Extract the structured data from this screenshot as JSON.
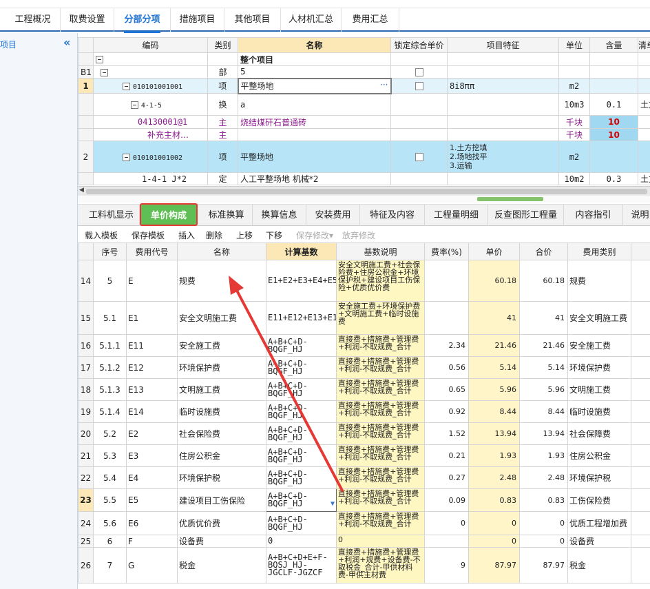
{
  "top_tabs": [
    "工程概况",
    "取费设置",
    "分部分项",
    "措施项目",
    "其他项目",
    "人材机汇总",
    "费用汇总"
  ],
  "left_panel": {
    "label": "项目",
    "collapse": "«"
  },
  "upper_grid": {
    "headers": [
      "编码",
      "类别",
      "名称",
      "锁定综合单价",
      "项目特征",
      "单位",
      "含量",
      "清单工作"
    ],
    "rows": [
      {
        "rn": "",
        "code": "",
        "type": "",
        "name": "整个项目",
        "feature": "",
        "unit": "",
        "qty": "",
        "work": ""
      },
      {
        "rn": "B1",
        "code": "",
        "type": "部",
        "name": "5",
        "feature": "",
        "unit": "",
        "qty": "",
        "work": ""
      },
      {
        "rn": "1",
        "code": "010101001001",
        "type": "项",
        "name": "平整场地",
        "feature": "8i8ππ",
        "unit": "m2",
        "qty": "",
        "work": ""
      },
      {
        "rn": "",
        "code": "4-1-5",
        "type": "换",
        "name": "a",
        "feature": "",
        "unit": "10m3",
        "qty": "0.1",
        "work": "土方挖填"
      },
      {
        "rn": "",
        "code": "04130001@1",
        "type": "主",
        "name": "烧结煤矸石普通砖",
        "feature": "",
        "unit": "千块",
        "qty": "10",
        "work": ""
      },
      {
        "rn": "",
        "code": "补充主材…",
        "type": "主",
        "name": "",
        "feature": "",
        "unit": "千块",
        "qty": "10",
        "work": ""
      },
      {
        "rn": "2",
        "code": "010101001002",
        "type": "项",
        "name": "平整场地",
        "feature": "1.土方挖填\n2.场地找平\n3.运输",
        "unit": "m2",
        "qty": "",
        "work": ""
      },
      {
        "rn": "",
        "code": "1-4-1 J*2",
        "type": "定",
        "name": "人工平整场地 机械*2",
        "feature": "",
        "unit": "10m2",
        "qty": "0.3",
        "work": "土方挖填"
      }
    ],
    "ellipsis": "···"
  },
  "lower_tabs": [
    "工料机显示",
    "单价构成",
    "标准换算",
    "换算信息",
    "安装费用",
    "特征及内容",
    "工程量明细",
    "反查图形工程量",
    "内容指引",
    "说明"
  ],
  "toolbar": [
    "载入模板",
    "保存模板",
    "插入",
    "删除",
    "上移",
    "下移",
    "保存修改",
    "放弃修改"
  ],
  "lower_grid": {
    "headers": [
      "",
      "序号",
      "费用代号",
      "名称",
      "计算基数",
      "基数说明",
      "费率(%)",
      "单价",
      "合价",
      "费用类别"
    ],
    "rows": [
      {
        "rn": "14",
        "seq": "5",
        "code": "E",
        "name": "规费",
        "base": "E1+E2+E3+E4+E5+E6",
        "desc": "安全文明施工费+社会保险费+住房公积金+环境保护税+建设项目工伤保险+优质优价费",
        "rate": "",
        "price": "60.18",
        "total": "60.18",
        "cat": "规费"
      },
      {
        "rn": "15",
        "seq": "5.1",
        "code": "E1",
        "name": "安全文明施工费",
        "base": "E11+E12+E13+E14",
        "desc": "安全施工费+环境保护费+文明施工费+临时设施费",
        "rate": "",
        "price": "41",
        "total": "41",
        "cat": "安全文明施工费"
      },
      {
        "rn": "16",
        "seq": "5.1.1",
        "code": "E11",
        "name": "安全施工费",
        "base": "A+B+C+D-BQGF_HJ",
        "desc": "直接费+措施费+管理费+利润-不取规费_合计",
        "rate": "2.34",
        "price": "21.46",
        "total": "21.46",
        "cat": "安全施工费"
      },
      {
        "rn": "17",
        "seq": "5.1.2",
        "code": "E12",
        "name": "环境保护费",
        "base": "A+B+C+D-BQGF_HJ",
        "desc": "直接费+措施费+管理费+利润-不取规费_合计",
        "rate": "0.56",
        "price": "5.14",
        "total": "5.14",
        "cat": "环境保护费"
      },
      {
        "rn": "18",
        "seq": "5.1.3",
        "code": "E13",
        "name": "文明施工费",
        "base": "A+B+C+D-BQGF_HJ",
        "desc": "直接费+措施费+管理费+利润-不取规费_合计",
        "rate": "0.65",
        "price": "5.96",
        "total": "5.96",
        "cat": "文明施工费"
      },
      {
        "rn": "19",
        "seq": "5.1.4",
        "code": "E14",
        "name": "临时设施费",
        "base": "A+B+C+D-BQGF_HJ",
        "desc": "直接费+措施费+管理费+利润-不取规费_合计",
        "rate": "0.92",
        "price": "8.44",
        "total": "8.44",
        "cat": "临时设施费"
      },
      {
        "rn": "20",
        "seq": "5.2",
        "code": "E2",
        "name": "社会保险费",
        "base": "A+B+C+D-BQGF_HJ",
        "desc": "直接费+措施费+管理费+利润-不取规费_合计",
        "rate": "1.52",
        "price": "13.94",
        "total": "13.94",
        "cat": "社会保障费"
      },
      {
        "rn": "21",
        "seq": "5.3",
        "code": "E3",
        "name": "住房公积金",
        "base": "A+B+C+D-BQGF_HJ",
        "desc": "直接费+措施费+管理费+利润-不取规费_合计",
        "rate": "0.21",
        "price": "1.93",
        "total": "1.93",
        "cat": "住房公积金"
      },
      {
        "rn": "22",
        "seq": "5.4",
        "code": "E4",
        "name": "环境保护税",
        "base": "A+B+C+D-BQGF_HJ",
        "desc": "直接费+措施费+管理费+利润-不取规费_合计",
        "rate": "0.27",
        "price": "2.48",
        "total": "2.48",
        "cat": "环境保护税"
      },
      {
        "rn": "23",
        "seq": "5.5",
        "code": "E5",
        "name": "建设项目工伤保险",
        "base": "A+B+C+D-BQGF_HJ",
        "desc": "直接费+措施费+管理费+利润-不取规费_合计",
        "rate": "0.09",
        "price": "0.83",
        "total": "0.83",
        "cat": "工伤保险费"
      },
      {
        "rn": "24",
        "seq": "5.6",
        "code": "E6",
        "name": "优质优价费",
        "base": "A+B+C+D-BQGF_HJ",
        "desc": "直接费+措施费+管理费+利润-不取规费_合计",
        "rate": "0",
        "price": "0",
        "total": "0",
        "cat": "优质工程增加费"
      },
      {
        "rn": "25",
        "seq": "6",
        "code": "F",
        "name": "设备费",
        "base": "0",
        "desc": "0",
        "rate": "",
        "price": "0",
        "total": "0",
        "cat": "设备费"
      },
      {
        "rn": "26",
        "seq": "7",
        "code": "G",
        "name": "税金",
        "base": "A+B+C+D+E+F-BQSJ_HJ-JGCLF-JGZCF",
        "desc": "直接费+措施费+管理费+利润+规费+设备费-不取税金_合计-甲供材料费-甲供主材费",
        "rate": "9",
        "price": "87.97",
        "total": "87.97",
        "cat": "税金"
      }
    ]
  },
  "colors": {
    "accent": "#1f73d6",
    "active_tab": "#5fbf54",
    "highlight_border": "#e53935",
    "arrow": "#e53935",
    "header_yellow": "#fbe8b6",
    "cell_yellow": "#fff7c2",
    "row_blue": "#b7e4f7"
  }
}
